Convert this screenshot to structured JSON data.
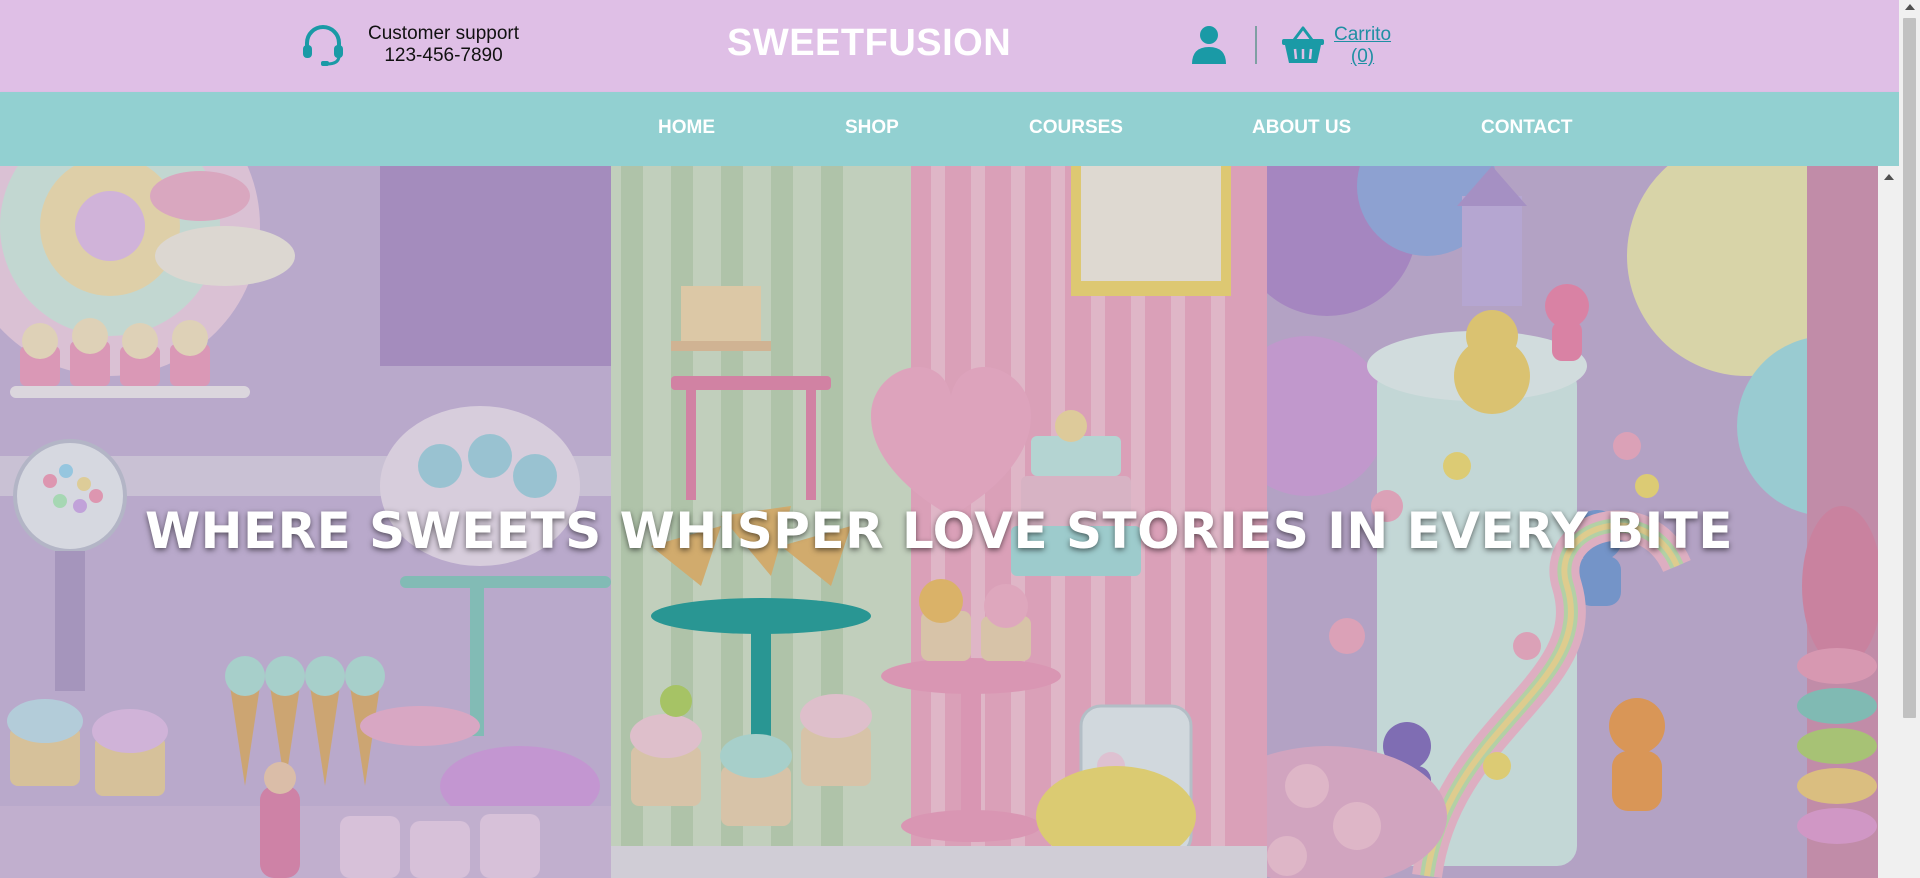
{
  "header": {
    "support_title": "Customer support",
    "support_phone": "123-456-7890",
    "brand": "SWEETFUSION",
    "cart_label": "Carrito",
    "cart_count": "(0)",
    "icons": [
      "headset-icon",
      "user-icon",
      "basket-icon"
    ],
    "colors": {
      "background": "#dfbfe6",
      "accent": "#1a9aa6"
    }
  },
  "nav": {
    "items": [
      {
        "label": "HOME"
      },
      {
        "label": "SHOP"
      },
      {
        "label": "COURSES"
      },
      {
        "label": "ABOUT US"
      },
      {
        "label": "CONTACT"
      }
    ],
    "colors": {
      "background": "#92d0d1"
    }
  },
  "hero": {
    "title": "WHERE SWEETS WHISPER LOVE STORIES IN EVERY BITE"
  }
}
